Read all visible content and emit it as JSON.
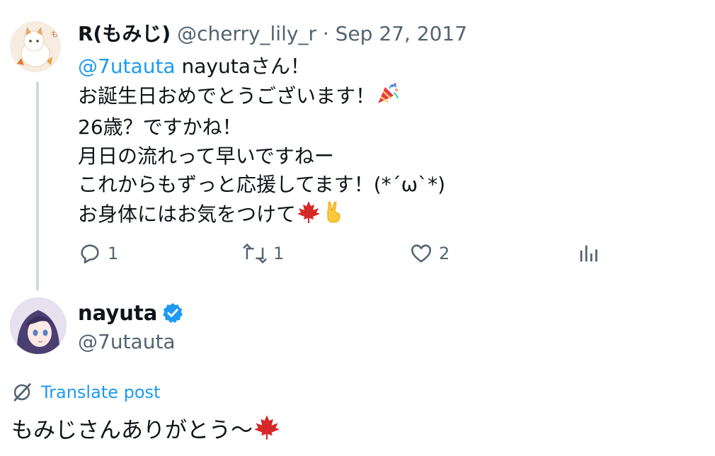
{
  "tweet": {
    "author_name": "R(もみじ)",
    "author_handle": "@cherry_lily_r",
    "separator": " · ",
    "date": "Sep 27, 2017",
    "mention": "@7utauta",
    "lines": [
      " nayutaさん！",
      "お誕生日おめでとうございます！",
      "26歳？ですかね！",
      "月日の流れって早いですねー",
      "これからもずっと応援してます！(*´ω`*)",
      "お身体にはお気をつけて"
    ],
    "counts": {
      "replies": "1",
      "retweets": "1",
      "likes": "2"
    }
  },
  "reply": {
    "author_name": "nayuta",
    "author_handle": "@7utauta",
    "translate_label": "Translate post",
    "text": "もみじさんありがとう〜"
  },
  "colors": {
    "accent": "#1d9bf0",
    "muted": "#536471",
    "text": "#0f1419",
    "thread_line": "#cfd9de"
  },
  "icons": [
    "reply-icon",
    "retweet-icon",
    "like-icon",
    "views-icon",
    "verified-badge-icon",
    "translate-icon",
    "party-popper-icon",
    "maple-leaf-icon",
    "victory-hand-icon"
  ]
}
